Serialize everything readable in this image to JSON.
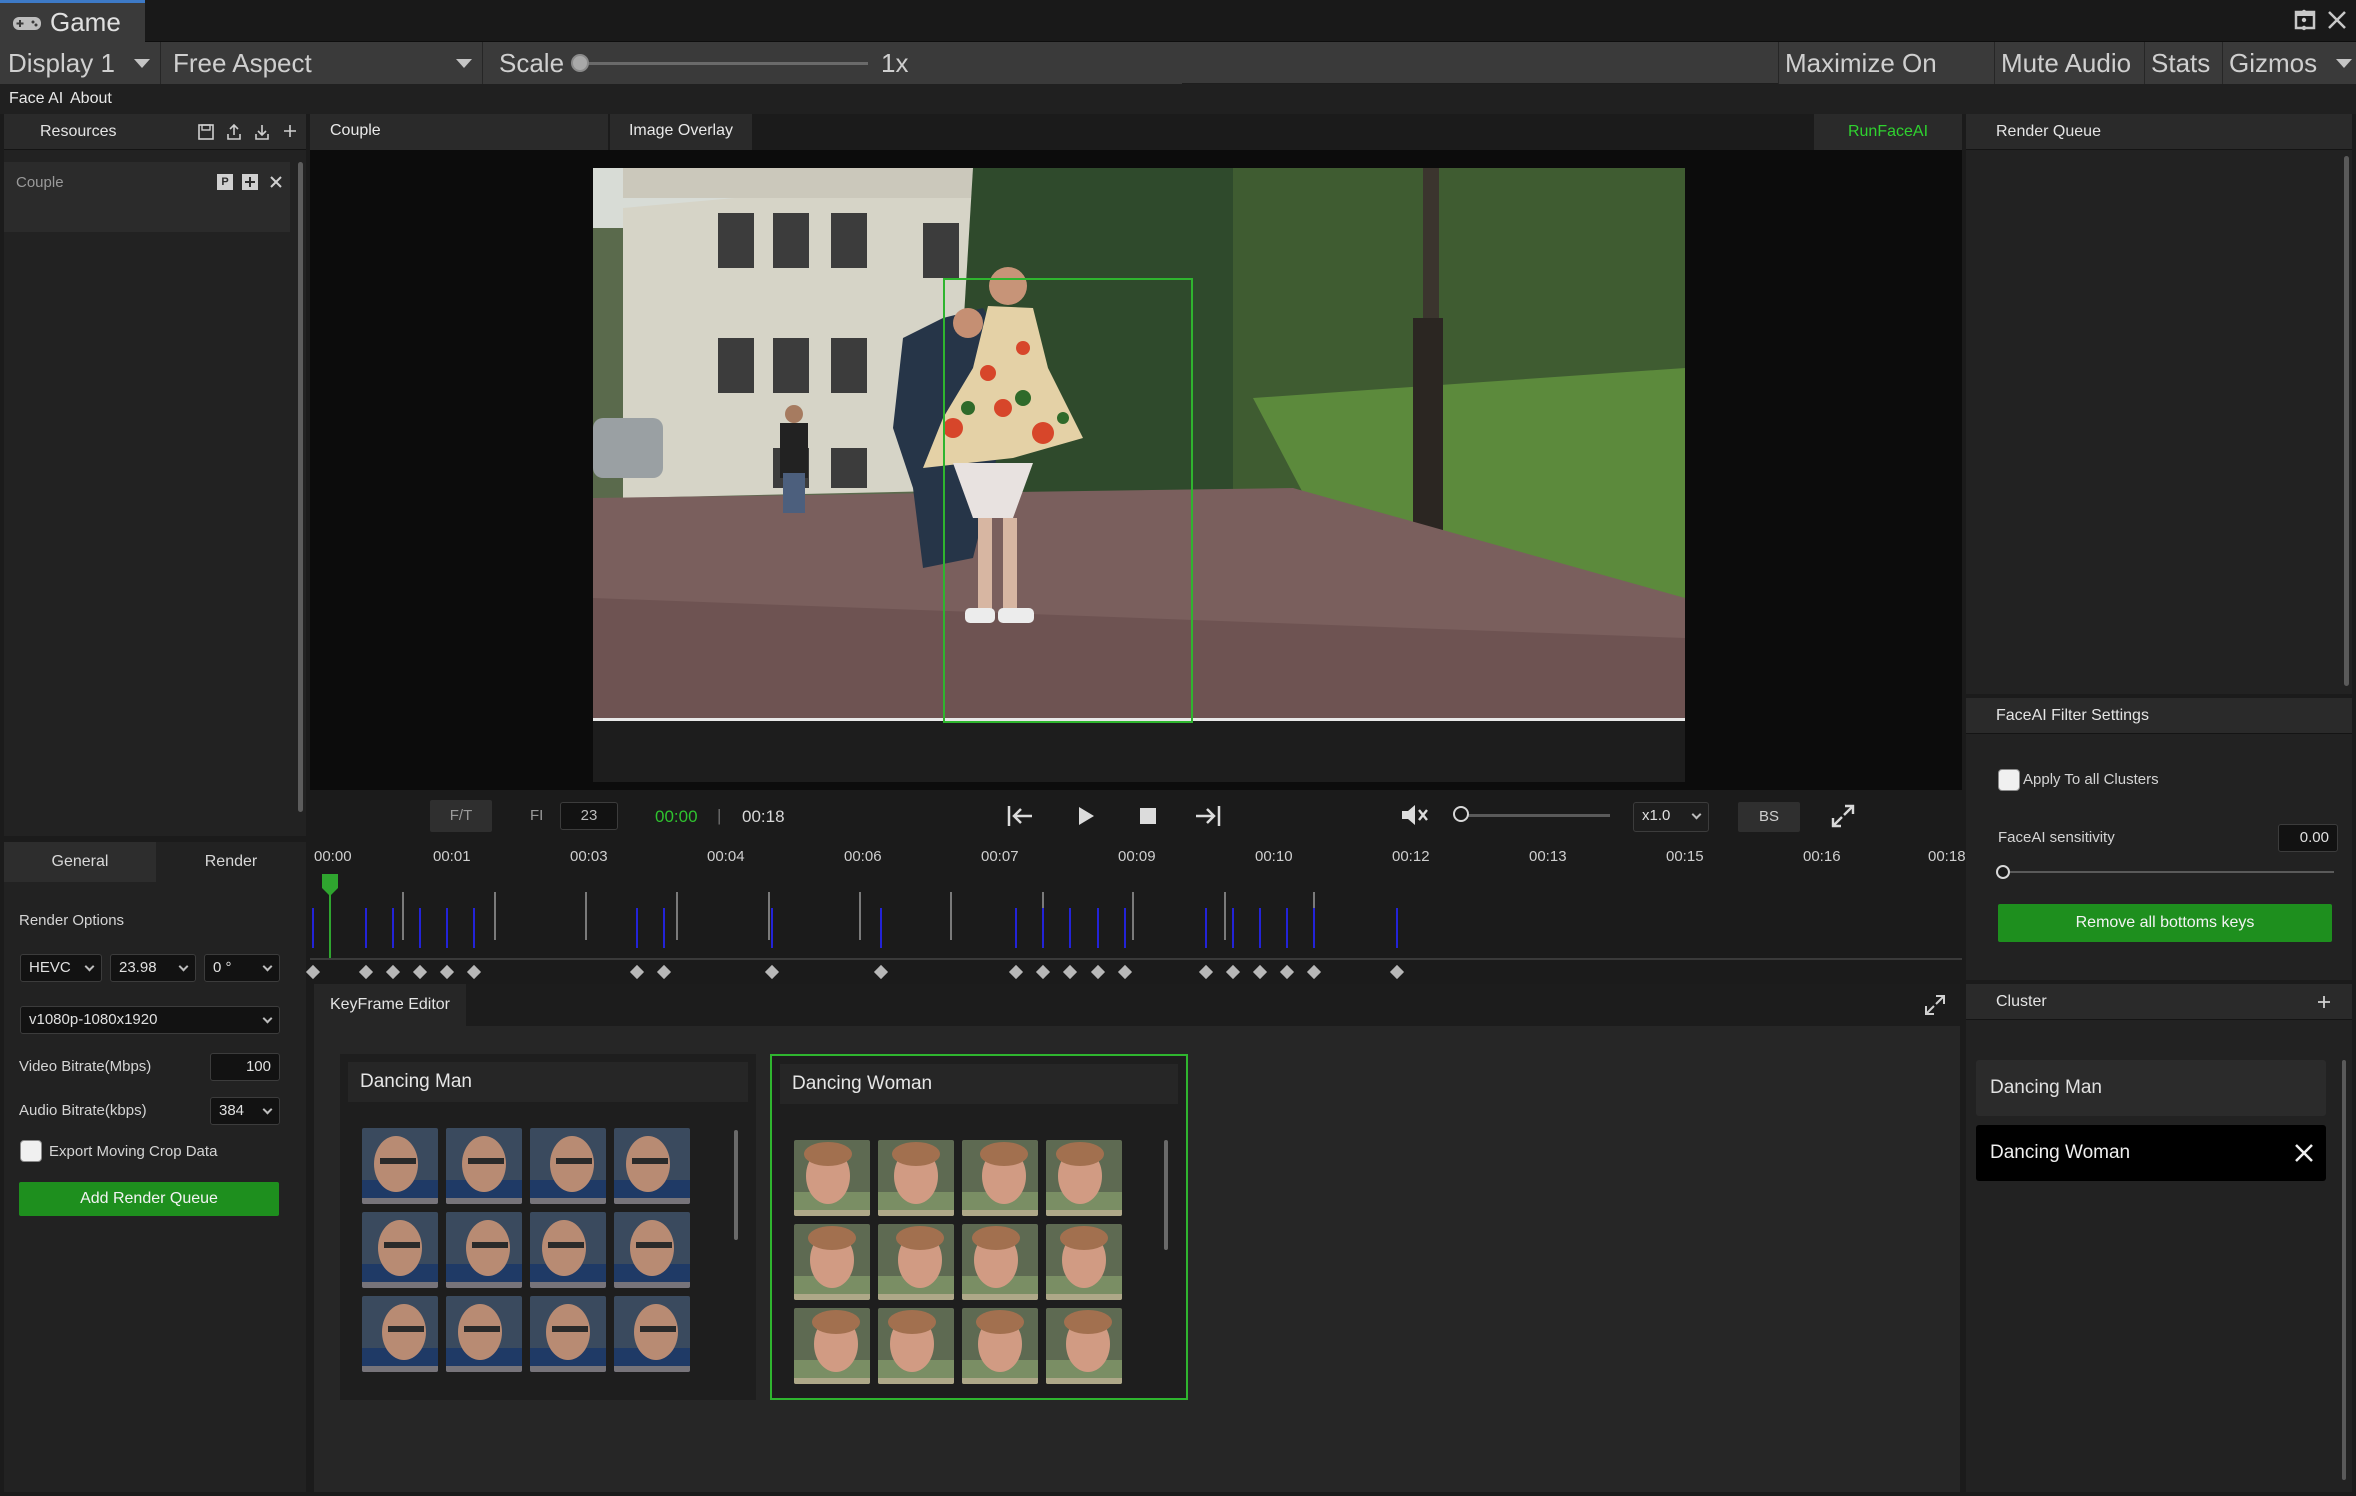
{
  "window": {
    "tab_title": "Game",
    "display": "Display 1",
    "aspect": "Free Aspect",
    "scale_label": "Scale",
    "scale_value": "1x",
    "toolbar_buttons": [
      "Maximize On Play",
      "Mute Audio",
      "Stats",
      "Gizmos"
    ]
  },
  "menu": {
    "items": [
      "Face AI",
      "About"
    ]
  },
  "resources": {
    "title": "Resources",
    "items": [
      {
        "label": "Couple"
      }
    ]
  },
  "viewer": {
    "tabs": [
      "Couple",
      "Image Overlay"
    ],
    "run_button": "RunFaceAI",
    "controls": {
      "ft_label": "F/T",
      "fi_label": "FI",
      "frame_input": "23",
      "current_time": "00:00",
      "separator": "|",
      "total_time": "00:18",
      "speed": "x1.0",
      "bs_label": "BS"
    }
  },
  "render_queue": {
    "title": "Render Queue"
  },
  "filter": {
    "title": "FaceAI Filter Settings",
    "apply_all_label": "Apply To all Clusters",
    "sensitivity_label": "FaceAI sensitivity",
    "sensitivity_value": "0.00",
    "remove_button": "Remove all bottoms keys"
  },
  "render_panel": {
    "tabs": [
      "General",
      "Render"
    ],
    "section_title": "Render Options",
    "codec": "HEVC",
    "fps": "23.98",
    "rotation": "0 °",
    "resolution": "v1080p-1080x1920",
    "video_bitrate_label": "Video Bitrate(Mbps)",
    "video_bitrate_value": "100",
    "audio_bitrate_label": "Audio Bitrate(kbps)",
    "audio_bitrate_value": "384",
    "export_crop_label": "Export Moving Crop Data",
    "add_queue_button": "Add Render Queue"
  },
  "timeline": {
    "ticks": [
      "00:00",
      "00:01",
      "00:03",
      "00:04",
      "00:06",
      "00:07",
      "00:09",
      "00:10",
      "00:12",
      "00:13",
      "00:15",
      "00:16",
      "00:18"
    ]
  },
  "keyframe_editor": {
    "title": "KeyFrame Editor",
    "clusters": [
      {
        "name": "Dancing Man",
        "thumbs": 12
      },
      {
        "name": "Dancing Woman",
        "thumbs": 12
      }
    ]
  },
  "cluster_panel": {
    "title": "Cluster",
    "items": [
      "Dancing Man",
      "Dancing Woman"
    ]
  },
  "colors": {
    "accent_green": "#1e8f1e",
    "selection_green": "#2fb52f",
    "keyframe_blue": "#2323d8"
  },
  "icons": [
    "gamepad-icon",
    "kebab-menu-icon",
    "maximize-icon",
    "close-icon",
    "save-icon",
    "upload-icon",
    "download-icon",
    "plus-icon",
    "play-icon",
    "stop-icon",
    "skip-start-icon",
    "skip-end-icon",
    "mute-icon",
    "expand-icon"
  ]
}
